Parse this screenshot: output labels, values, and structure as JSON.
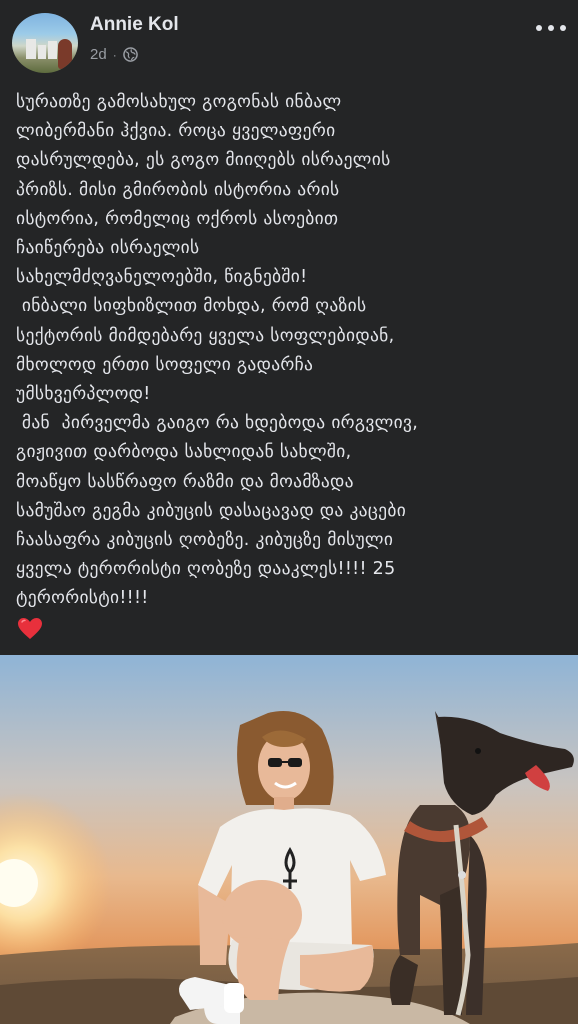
{
  "post": {
    "author": "Annie Kol",
    "time": "2d",
    "separator": "·",
    "audience_icon": "globe-icon",
    "more_icon": "more-horizontal-icon",
    "text": "სურათზე გამოსახულ გოგონას ინბალ\nლიბერმანი ჰქვია. როცა ყველაფერი\nდასრულდება, ეს გოგო მიიღებს ისრაელის\nპრიზს. მისი გმირობის ისტორია არის\nისტორია, რომელიც ოქროს ასოებით\nჩაიწერება ისრაელის\nსახელმძღვანელოებში, წიგნებში!\n ინბალი სიფხიზლით მოხდა, რომ ღაზის\nსექტორის მიმდებარე ყველა სოფლებიდან,\nმხოლოდ ერთი სოფელი გადარჩა\nუმსხვერპლოდ!\n მან  პირველმა გაიგო რა ხდებოდა ირგვლივ,\nგიჟივით დარბოდა სახლიდან სახლში,\nმოაწყო სასწრაფო რაზმი და მოამზადა\nსამუშაო გეგმა კიბუცის დასაცავად და კაცები\nჩაასაფრა კიბუცის ღობეზე. კიბუცზე მისული\nყველა ტერორისტი ღობეზე დააკლეს!!!! 25\nტერორისტი!!!!",
    "emoji": "heart-icon"
  },
  "colors": {
    "background": "#242526",
    "text": "#e4e6eb",
    "meta": "#9a9ea4",
    "heart": "#e8303c"
  }
}
